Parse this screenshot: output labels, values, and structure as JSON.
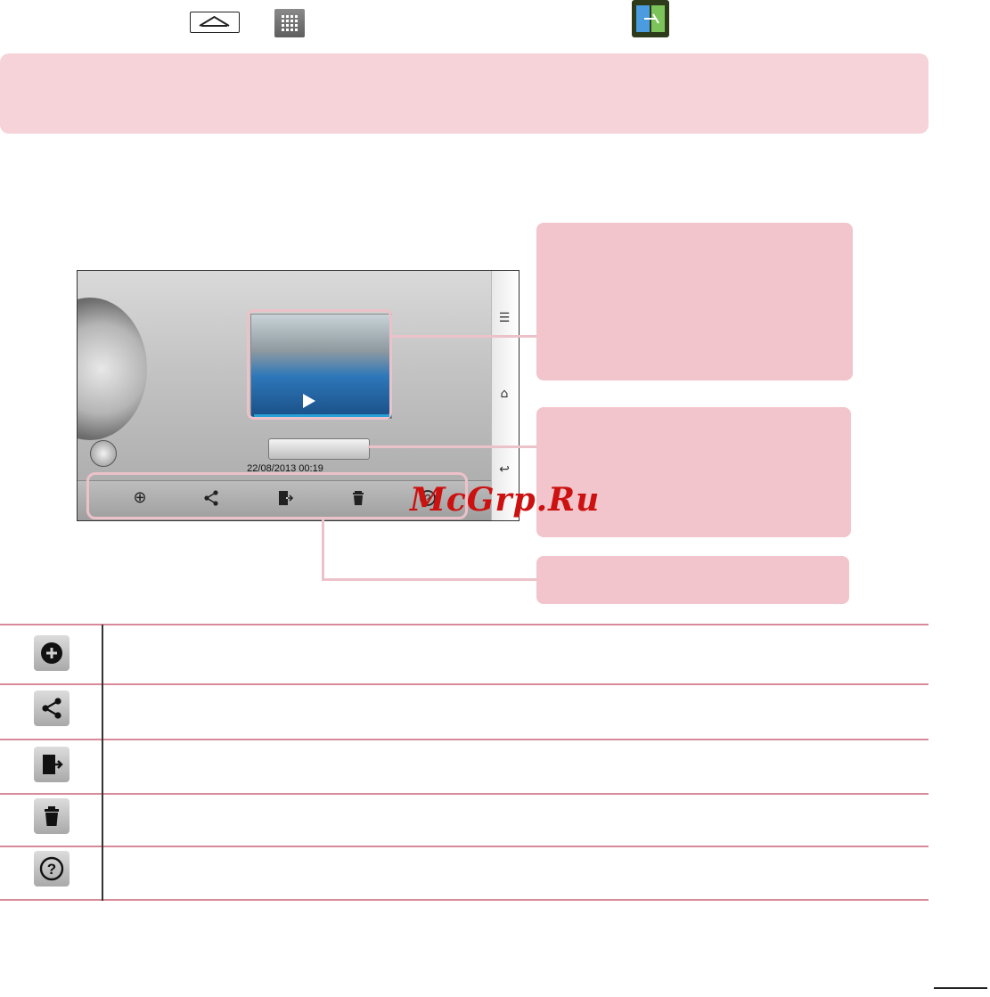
{
  "header_icons": {
    "home": "home-key-icon",
    "apps": "apps-grid-icon",
    "app": "video-editor-app-icon"
  },
  "phone": {
    "date": "22/08/2013 00:19",
    "toolbar_icons": [
      "add-icon",
      "share-icon",
      "export-icon",
      "delete-icon",
      "help-icon"
    ],
    "rail_icons": [
      "menu-icon",
      "home-icon",
      "back-icon"
    ]
  },
  "watermark": "McGrp.Ru",
  "table": {
    "rows": [
      {
        "icon": "add-icon"
      },
      {
        "icon": "share-icon"
      },
      {
        "icon": "export-icon"
      },
      {
        "icon": "delete-icon"
      },
      {
        "icon": "help-icon"
      }
    ]
  },
  "colors": {
    "callout": "#f2c4cb",
    "banner": "#f5d3d8",
    "rule": "#d98a9a"
  }
}
